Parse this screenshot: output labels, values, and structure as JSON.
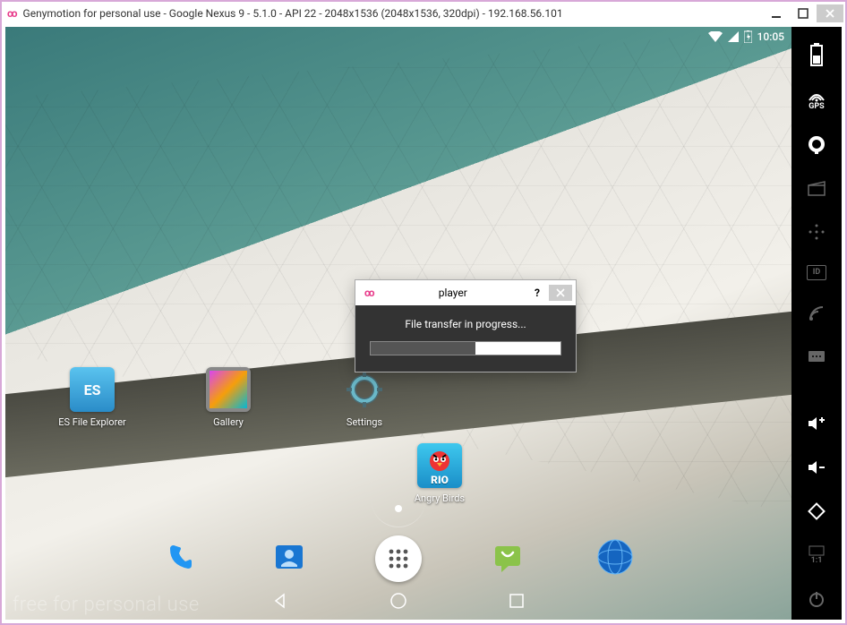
{
  "window": {
    "title": "Genymotion for personal use - Google Nexus 9 - 5.1.0 - API 22 - 2048x1536 (2048x1536, 320dpi) - 192.168.56.101"
  },
  "status": {
    "time": "10:05"
  },
  "home_apps_row1": [
    {
      "label": "ES File Explorer",
      "color": "#2aa3dd",
      "text": "ES"
    },
    {
      "label": "Gallery",
      "color": "#555",
      "text": ""
    },
    {
      "label": "Settings",
      "color": "transparent",
      "text": ""
    }
  ],
  "home_apps_row2": [
    {
      "label": "Angry Birds",
      "color": "#2cb4e8",
      "text": "RIO"
    }
  ],
  "toolbar": {
    "gps": "GPS",
    "id": "ID",
    "ratio": "1:1"
  },
  "watermark": "free for personal use",
  "dialog": {
    "title": "player",
    "message": "File transfer in progress...",
    "progress_pct": 55
  }
}
